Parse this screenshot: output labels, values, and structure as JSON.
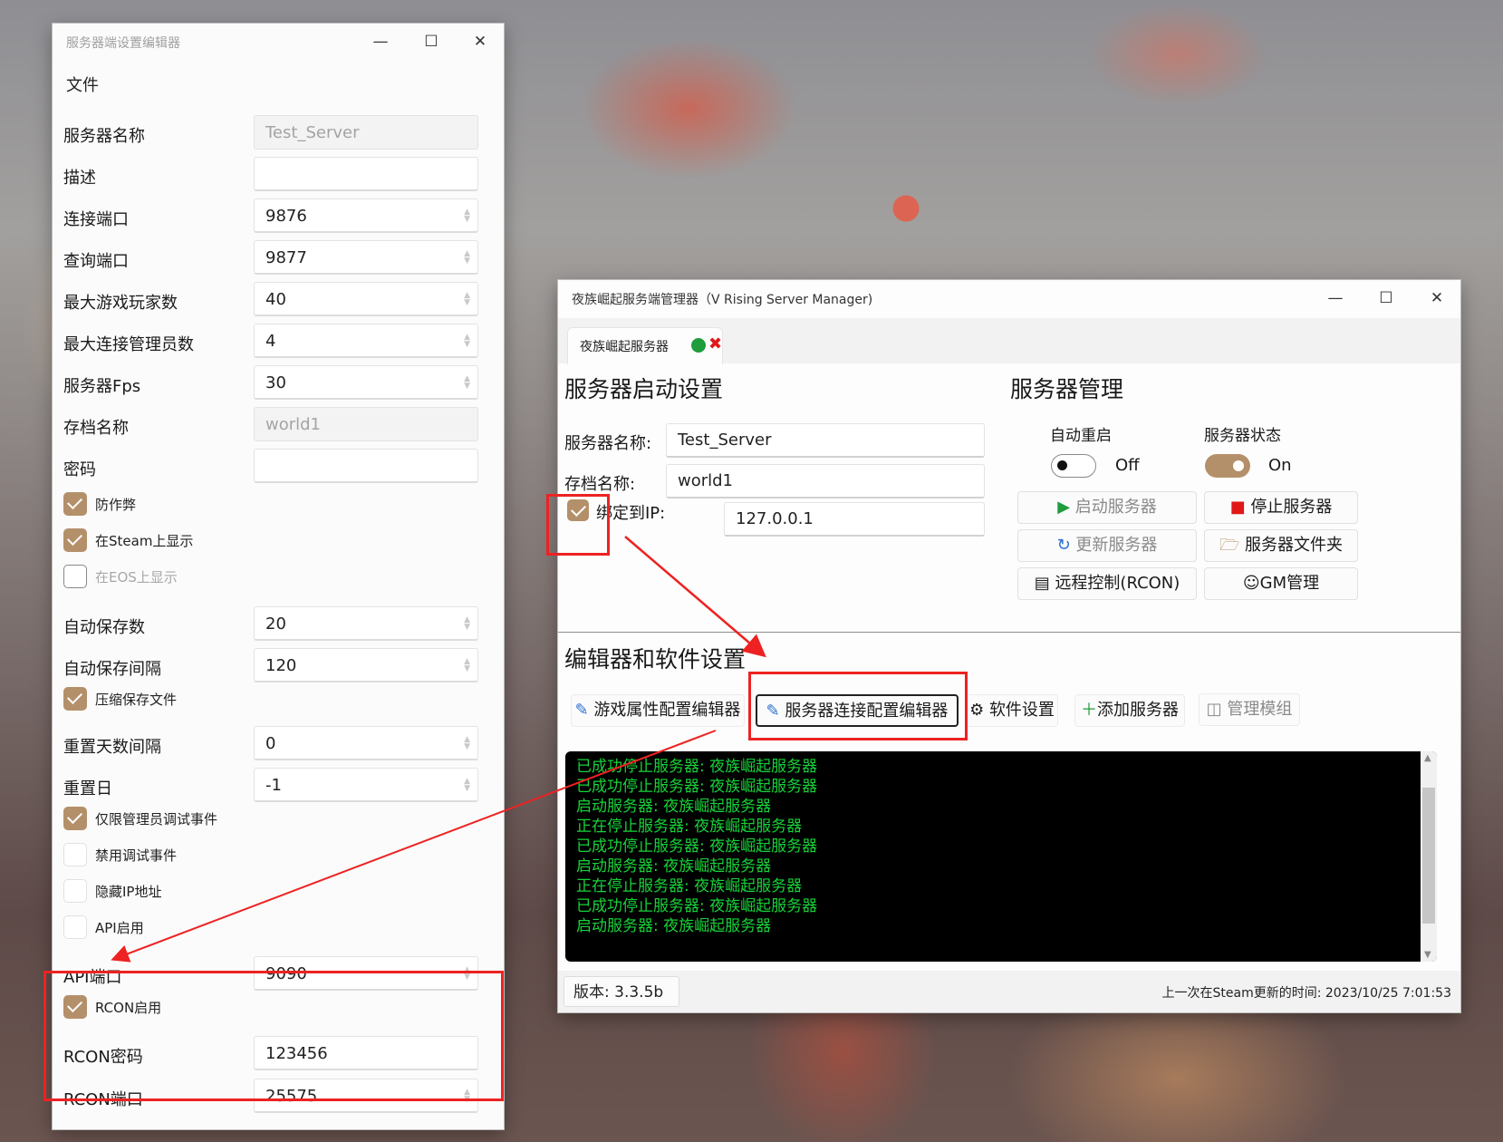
{
  "left_window": {
    "title": "服务器端设置编辑器",
    "menu_file": "文件",
    "rows": [
      {
        "label": "服务器名称",
        "value": "Test_Server"
      },
      {
        "label": "描述",
        "value": ""
      },
      {
        "label": "连接端口",
        "value": "9876"
      },
      {
        "label": "查询端口",
        "value": "9877"
      },
      {
        "label": "最大游戏玩家数",
        "value": "40"
      },
      {
        "label": "最大连接管理员数",
        "value": "4"
      },
      {
        "label": "服务器Fps",
        "value": "30"
      },
      {
        "label": "存档名称",
        "value": "world1"
      },
      {
        "label": "密码",
        "value": ""
      },
      {
        "label": "自动保存数",
        "value": "20"
      },
      {
        "label": "自动保存间隔",
        "value": "120"
      },
      {
        "label": "重置天数间隔",
        "value": "0"
      },
      {
        "label": "重置日",
        "value": "-1"
      },
      {
        "label": "API端口",
        "value": "9090"
      },
      {
        "label": "RCON密码",
        "value": "123456"
      },
      {
        "label": "RCON端口",
        "value": "25575"
      }
    ],
    "checks": [
      {
        "label": "防作弊",
        "checked": true
      },
      {
        "label": "在Steam上显示",
        "checked": true
      },
      {
        "label": "在EOS上显示",
        "checked": false
      },
      {
        "label": "压缩保存文件",
        "checked": true
      },
      {
        "label": "仅限管理员调试事件",
        "checked": true
      },
      {
        "label": "禁用调试事件",
        "checked": false
      },
      {
        "label": "隐藏IP地址",
        "checked": false
      },
      {
        "label": "API启用",
        "checked": false
      },
      {
        "label": "RCON启用",
        "checked": true
      }
    ]
  },
  "right_window": {
    "title": "夜族崛起服务端管理器（V Rising Server Manager)",
    "tab_label": "夜族崛起服务器",
    "tab_close": "✖",
    "launch": {
      "heading": "服务器启动设置",
      "server_name_label": "服务器名称:",
      "server_name": "Test_Server",
      "save_name_label": "存档名称:",
      "save_name": "world1",
      "bind_ip_label": "绑定到IP:",
      "bind_ip": "127.0.0.1",
      "bind_ip_checked": true
    },
    "manage": {
      "heading": "服务器管理",
      "auto_restart_label": "自动重启",
      "auto_restart_state": "Off",
      "server_status_label": "服务器状态",
      "server_status_state": "On",
      "start": "启动服务器",
      "stop": "停止服务器",
      "update": "更新服务器",
      "folder": "服务器文件夹",
      "rcon": "远程控制(RCON)",
      "gm": "GM管理"
    },
    "editor": {
      "heading": "编辑器和软件设置",
      "game_editor": "游戏属性配置编辑器",
      "server_editor": "服务器连接配置编辑器",
      "software_settings": "软件设置",
      "add_server": "添加服务器",
      "manage_mods": "管理模组"
    },
    "console": [
      "已成功停止服务器: 夜族崛起服务器",
      "已成功停止服务器: 夜族崛起服务器",
      "启动服务器: 夜族崛起服务器",
      "正在停止服务器: 夜族崛起服务器",
      "已成功停止服务器: 夜族崛起服务器",
      "启动服务器: 夜族崛起服务器",
      "正在停止服务器: 夜族崛起服务器",
      "已成功停止服务器: 夜族崛起服务器",
      "启动服务器: 夜族崛起服务器"
    ],
    "status": {
      "version_label": "版本:",
      "version": "3.3.5b",
      "last_update": "上一次在Steam更新的时间: 2023/10/25 7:01:53"
    }
  },
  "colors": {
    "accent": "#b4906a",
    "console_text": "#18d33a",
    "annotation": "#ee2222",
    "status_dot": "#1f9c3c"
  }
}
